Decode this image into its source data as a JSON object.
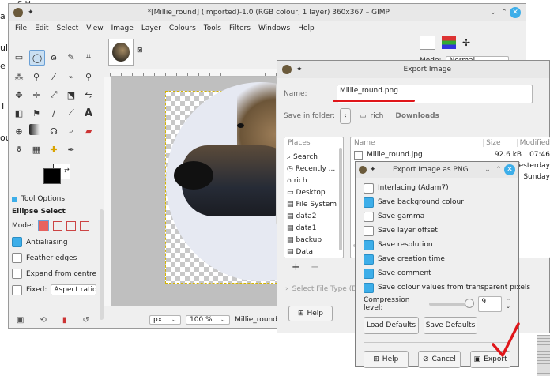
{
  "background_text": {
    "lines": [
      "a",
      "ul",
      "e",
      "I",
      "ou"
    ],
    "top_fragment": "S        H"
  },
  "gimp": {
    "title": "*[Millie_round] (imported)-1.0 (RGB colour, 1 layer) 360x367 – GIMP",
    "menu": [
      "File",
      "Edit",
      "Select",
      "View",
      "Image",
      "Layer",
      "Colours",
      "Tools",
      "Filters",
      "Windows",
      "Help"
    ],
    "tab_close": "⊠",
    "tool_options": {
      "tab_label": "Tool Options",
      "title": "Ellipse Select",
      "mode_label": "Mode:",
      "options": [
        {
          "label": "Antialiasing",
          "checked": true
        },
        {
          "label": "Feather edges",
          "checked": false
        },
        {
          "label": "Expand from centre",
          "checked": false
        }
      ],
      "fixed_label": "Fixed:",
      "fixed_value": "Aspect ratio"
    },
    "layers_mode_label": "Mode:",
    "layers_mode_value": "Normal",
    "status": {
      "unit": "px",
      "zoom": "100 %",
      "filename": "Millie_round.jpg (2.7"
    }
  },
  "export_image": {
    "title": "Export Image",
    "name_label": "Name:",
    "name_value": "Millie_round.png",
    "folder_label": "Save in folder:",
    "folder_path": [
      "rich",
      "Downloads"
    ],
    "places_header": "Places",
    "places": [
      "Search",
      "Recently ...",
      "rich",
      "Desktop",
      "File System",
      "data2",
      "data1",
      "backup",
      "Data"
    ],
    "columns": [
      "Name",
      "Size",
      "Modified"
    ],
    "files": [
      {
        "name": "Millie_round.jpg",
        "size": "92.6 kB",
        "time": "07:46"
      },
      {
        "name": "",
        "size": "",
        "time": "Yesterday"
      },
      {
        "name": "",
        "size": "",
        "time": "Sunday"
      }
    ],
    "add_label": "+",
    "remove_label": "−",
    "select_type_label": "Select File Type (By E",
    "help_label": "Help"
  },
  "export_png": {
    "title": "Export Image as PNG",
    "options": [
      {
        "label": "Interlacing (Adam7)",
        "checked": false
      },
      {
        "label": "Save background colour",
        "checked": true
      },
      {
        "label": "Save gamma",
        "checked": false
      },
      {
        "label": "Save layer offset",
        "checked": false
      },
      {
        "label": "Save resolution",
        "checked": true
      },
      {
        "label": "Save creation time",
        "checked": true
      },
      {
        "label": "Save comment",
        "checked": true
      },
      {
        "label": "Save colour values from transparent pixels",
        "checked": true
      }
    ],
    "compression_label": "Compression level:",
    "compression_value": "9",
    "compression_fraction": 1.0,
    "load_defaults": "Load Defaults",
    "save_defaults": "Save Defaults",
    "help_label": "Help",
    "cancel_label": "Cancel",
    "export_label": "Export"
  },
  "colors": {
    "accent": "#3daee9",
    "annotation": "#e0161a",
    "titlebar": "#e8e8e8"
  }
}
